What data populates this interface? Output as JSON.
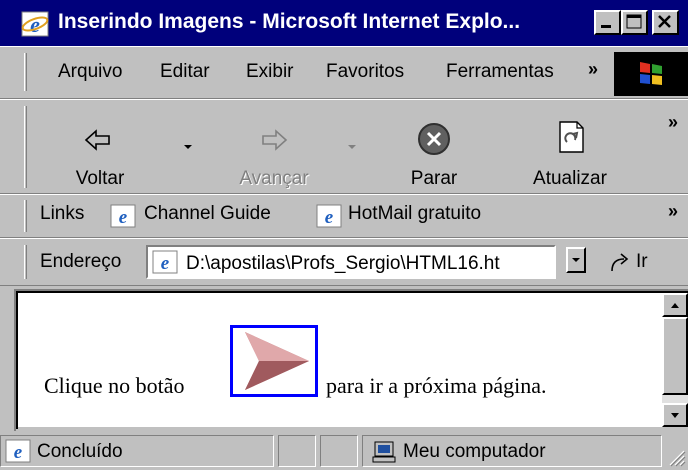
{
  "window": {
    "title": "Inserindo Imagens - Microsoft Internet Explo...",
    "controls": [
      "minimize",
      "maximize",
      "close"
    ]
  },
  "menu": {
    "items": [
      {
        "label": "Arquivo"
      },
      {
        "label": "Editar"
      },
      {
        "label": "Exibir"
      },
      {
        "label": "Favoritos"
      },
      {
        "label": "Ferramentas"
      }
    ],
    "more": "»"
  },
  "toolbar": {
    "back": {
      "label": "Voltar",
      "icon": "back-arrow-icon"
    },
    "forward": {
      "label": "Avançar",
      "icon": "forward-arrow-icon",
      "disabled": true
    },
    "stop": {
      "label": "Parar",
      "icon": "stop-icon"
    },
    "refresh": {
      "label": "Atualizar",
      "icon": "refresh-icon"
    },
    "more": "»"
  },
  "links": {
    "label": "Links",
    "items": [
      {
        "label": "Channel Guide"
      },
      {
        "label": "HotMail gratuito"
      }
    ],
    "more": "»"
  },
  "address": {
    "label": "Endereço",
    "value": "D:\\apostilas\\Profs_Sergio\\HTML16.ht",
    "go_label": "Ir"
  },
  "content": {
    "before": "Clique no botão",
    "after": "para ir a próxima página."
  },
  "status": {
    "text": "Concluído",
    "zone": "Meu computador"
  },
  "colors": {
    "titlebar": "#00007b",
    "face": "#c0c0c0",
    "image_border": "#0000ff",
    "arrow": "#c0787c"
  }
}
